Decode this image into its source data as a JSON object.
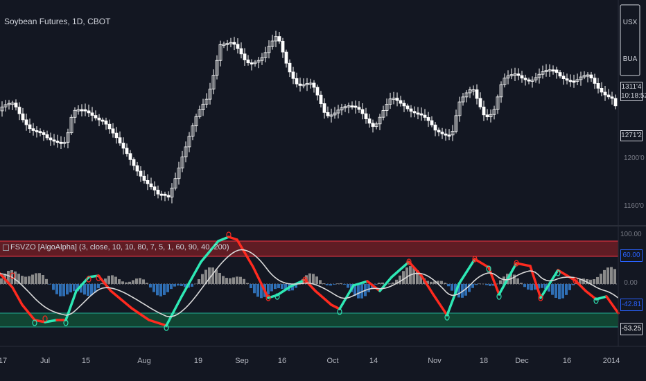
{
  "symbol": {
    "title": "Soybean Futures, 1D, CBOT"
  },
  "indicator": {
    "title": "FSVZO [AlgoAlpha] (3, close, 10, 10, 80, 7, 5, 1, 60, 90, 40, 200)"
  },
  "side_buttons": {
    "currency": "USX",
    "unit": "BUA"
  },
  "price_axis": {
    "current_price": "1311'4",
    "countdown": "10:18:52",
    "last_label": "1271'2",
    "labels": [
      "1200'0",
      "1160'0"
    ]
  },
  "osc_axis": {
    "labels": [
      "100.00",
      "60.00",
      "0.00",
      "-42.81",
      "-53.25"
    ]
  },
  "time_axis": {
    "labels": [
      "17",
      "Jul",
      "15",
      "Aug",
      "19",
      "Sep",
      "16",
      "Oct",
      "14",
      "Nov",
      "18",
      "Dec",
      "16",
      "2014"
    ]
  },
  "colors": {
    "background": "#131722",
    "candle": "#ffffff",
    "bull_osc": "#2ee8b5",
    "bear_osc": "#ff2a1f",
    "signal": "#d9d9d9",
    "hist_pos": "#8a8a8a",
    "hist_neg": "#2f6fb5",
    "ob_zone": "#6e1d24",
    "os_zone": "#124e36",
    "level_blue": "#2962ff"
  }
}
